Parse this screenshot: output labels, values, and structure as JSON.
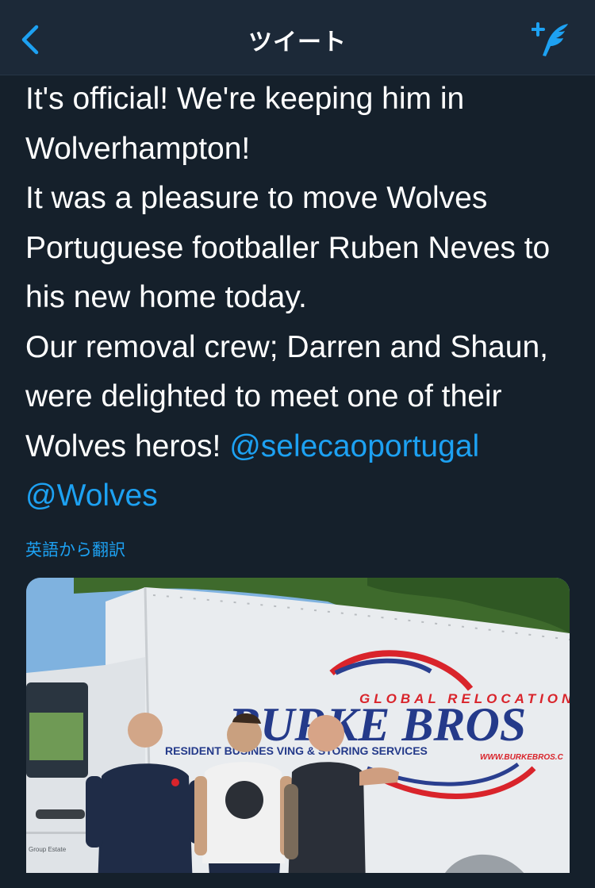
{
  "nav": {
    "title": "ツイート"
  },
  "tweet": {
    "lines": [
      "It's official! We're keeping him in",
      "Wolverhampton!",
      "It was a pleasure to move Wolves",
      "Portuguese footballer Ruben Neves to",
      "his new home today.",
      "Our removal crew; Darren and Shaun,",
      "were delighted to meet one of their"
    ],
    "last_line_text": "Wolves heros! ",
    "mention_1": "@selecaoportugal",
    "mention_2": "@Wolves"
  },
  "translate_label": "英語から翻訳",
  "media": {
    "van_brand_top": "GLOBAL RELOCATION",
    "van_brand_main": "BURKE BROS",
    "van_services": "RESIDENT   BUSINES   VING & STORING SERVICES",
    "van_url": "WWW.BURKEBROS.C",
    "small_sign": "Group Estate"
  },
  "colors": {
    "background": "#15202b",
    "nav_background": "#1c2938",
    "accent": "#1da1f2",
    "text": "#ffffff"
  },
  "icons": {
    "back": "chevron-left-icon",
    "compose": "compose-tweet-icon"
  }
}
